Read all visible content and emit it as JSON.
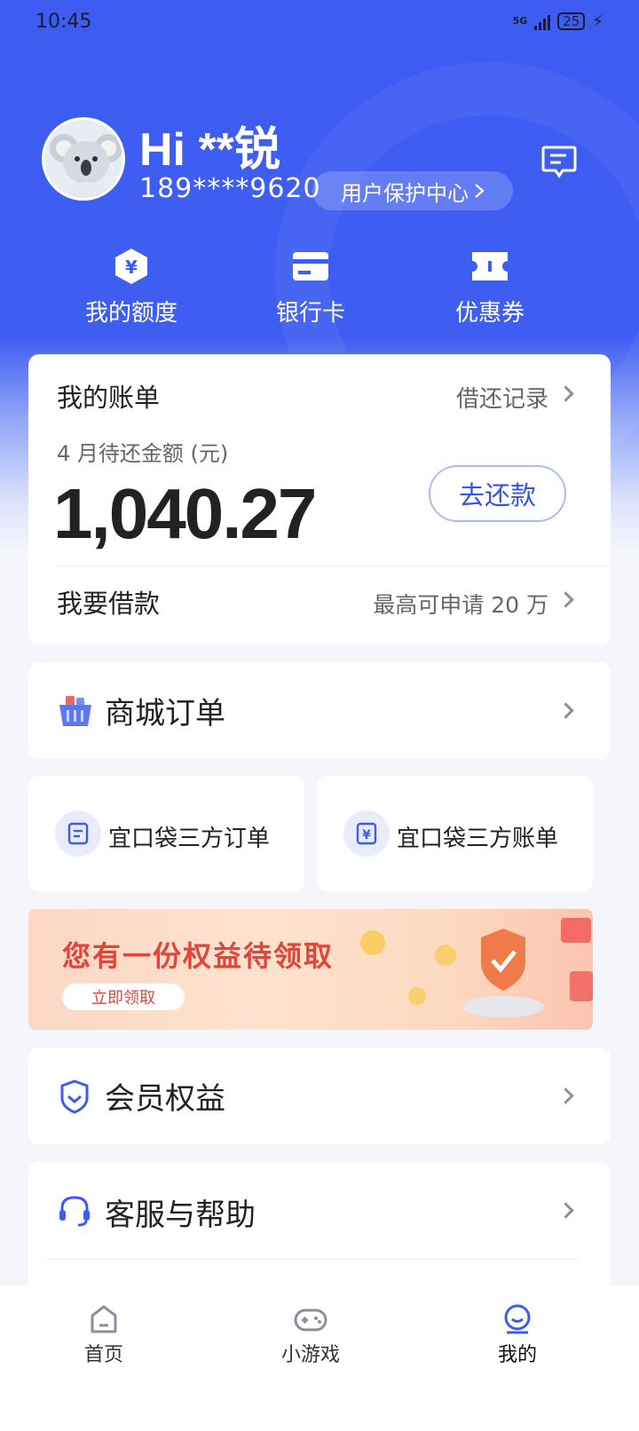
{
  "status": {
    "time": "10:45",
    "network": "5G",
    "battery": "25"
  },
  "profile": {
    "greeting": "Hi **锐",
    "phone": "189****9620",
    "protection_center": "用户保护中心",
    "message_icon": "message-icon"
  },
  "quick_actions": [
    {
      "label": "我的额度",
      "icon": "quota-icon"
    },
    {
      "label": "银行卡",
      "icon": "bank-card-icon"
    },
    {
      "label": "优惠券",
      "icon": "coupon-icon"
    }
  ],
  "bill": {
    "title": "我的账单",
    "history_link": "借还记录",
    "due_label": "4 月待还金额 (元)",
    "due_amount": "1,040.27",
    "repay_button": "去还款",
    "borrow_title": "我要借款",
    "borrow_note": "最高可申请 20 万"
  },
  "mall_orders": {
    "label": "商城订单",
    "icon": "shopping-basket-icon"
  },
  "third_party": {
    "orders": "宜口袋三方订单",
    "bills": "宜口袋三方账单"
  },
  "banner": {
    "title": "您有一份权益待领取",
    "button": "立即领取"
  },
  "membership": {
    "label": "会员权益",
    "icon": "member-badge-icon"
  },
  "service": {
    "label": "客服与帮助",
    "icon": "headset-icon"
  },
  "tabbar": {
    "items": [
      {
        "label": "首页",
        "icon": "home-icon",
        "active": false
      },
      {
        "label": "小游戏",
        "icon": "gamepad-icon",
        "active": false
      },
      {
        "label": "我的",
        "icon": "profile-icon",
        "active": true
      }
    ]
  },
  "colors": {
    "primary": "#3d5cf2",
    "accent_text": "#3455e6",
    "banner_red": "#e0463b"
  }
}
